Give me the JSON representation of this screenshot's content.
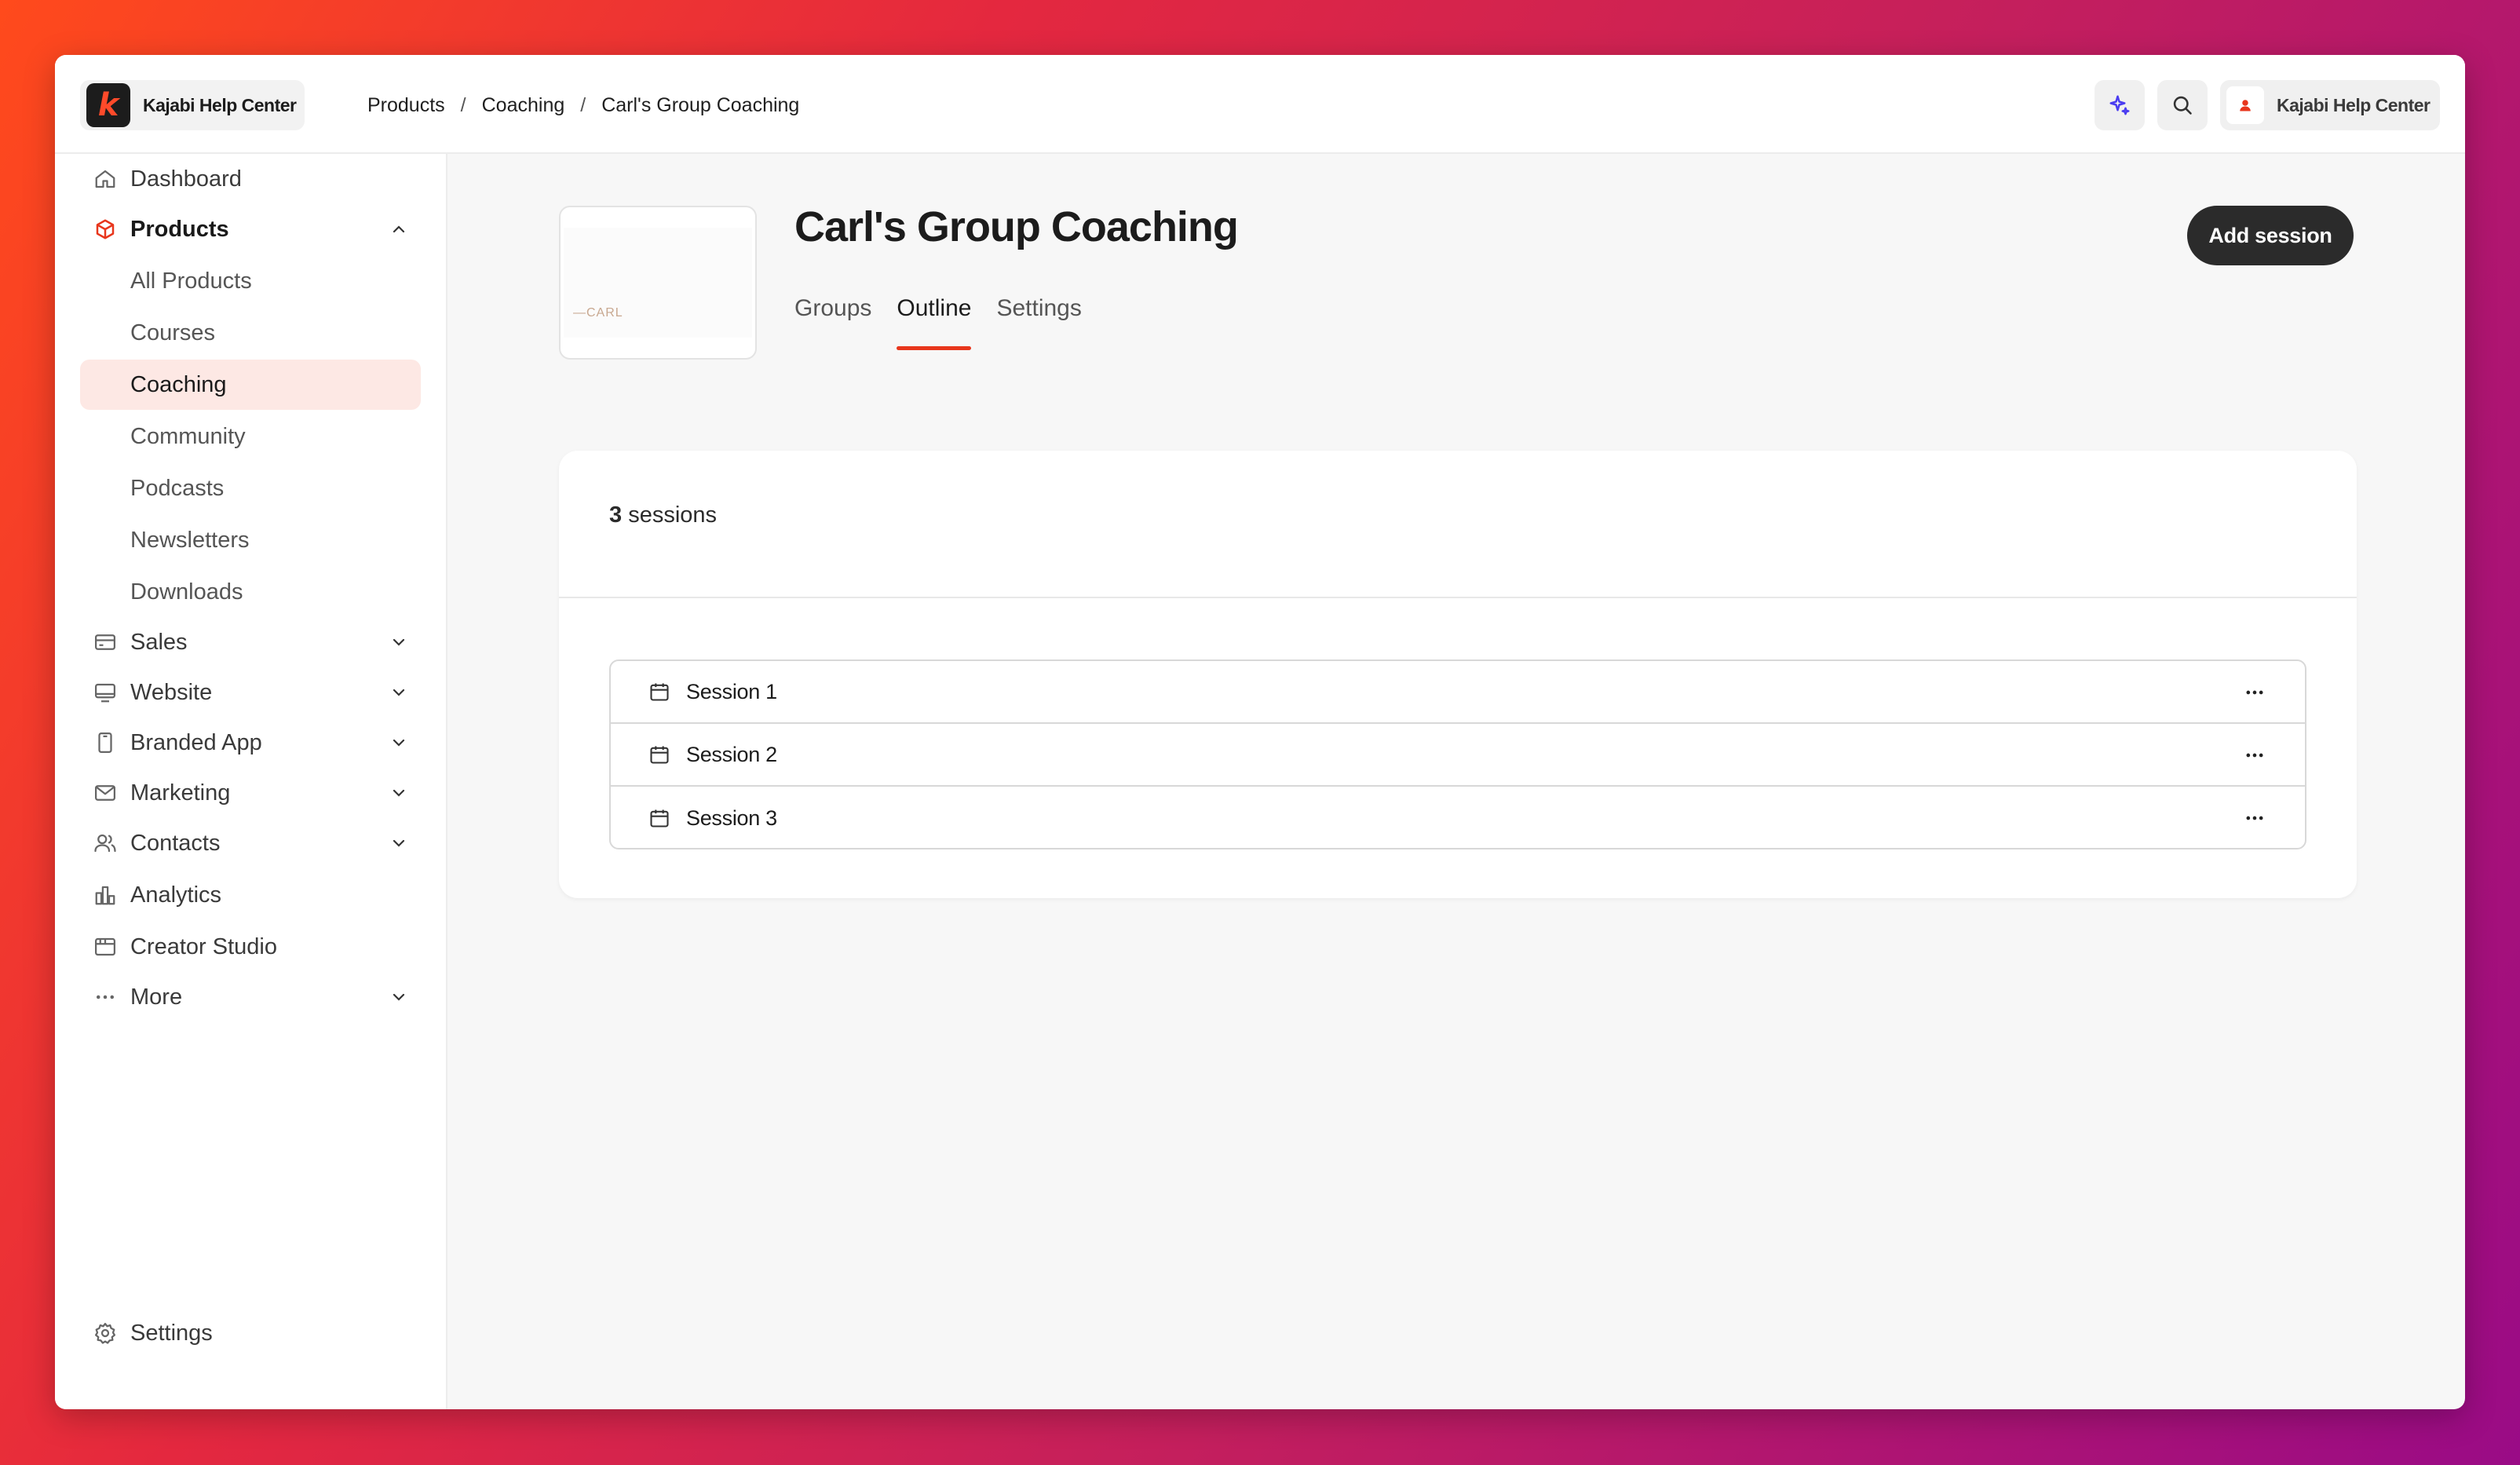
{
  "app": {
    "brand_name": "Kajabi Help Center",
    "brand_logo_letter": "k",
    "accent_color": "#e8361c"
  },
  "breadcrumb": [
    "Products",
    "Coaching",
    "Carl's Group Coaching"
  ],
  "breadcrumb_separator": "/",
  "topbar": {
    "ai_icon": "sparkle-icon",
    "search_icon": "search-icon",
    "user_name": "Kajabi Help Center"
  },
  "sidebar": {
    "items": [
      {
        "label": "Dashboard",
        "icon": "home-icon"
      },
      {
        "label": "Products",
        "icon": "box-icon",
        "expanded": true
      },
      {
        "label": "Sales",
        "icon": "credit-card-icon"
      },
      {
        "label": "Website",
        "icon": "monitor-icon"
      },
      {
        "label": "Branded App",
        "icon": "phone-icon"
      },
      {
        "label": "Marketing",
        "icon": "mail-icon"
      },
      {
        "label": "Contacts",
        "icon": "users-icon"
      },
      {
        "label": "Analytics",
        "icon": "chart-icon"
      },
      {
        "label": "Creator Studio",
        "icon": "studio-icon"
      },
      {
        "label": "More",
        "icon": "dots-icon"
      }
    ],
    "product_subitems": [
      "All Products",
      "Courses",
      "Coaching",
      "Community",
      "Podcasts",
      "Newsletters",
      "Downloads"
    ],
    "selected_subitem": "Coaching",
    "settings_label": "Settings"
  },
  "main": {
    "thumbnail_text": "—CARL",
    "title": "Carl's Group Coaching",
    "tabs": [
      "Groups",
      "Outline",
      "Settings"
    ],
    "active_tab": "Outline",
    "add_button": "Add session",
    "sessions_count": "3",
    "sessions_word": "sessions",
    "sessions": [
      "Session 1",
      "Session 2",
      "Session 3"
    ]
  }
}
